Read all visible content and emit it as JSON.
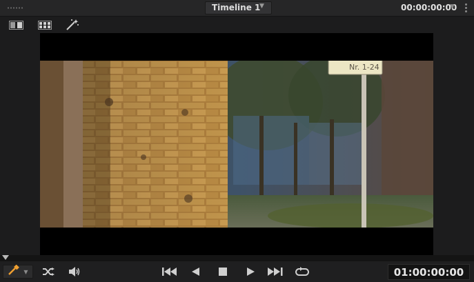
{
  "header": {
    "timeline_title": "Timeline 1",
    "timecode": "00:00:00:00"
  },
  "toolbar": {
    "icons": [
      "split-view-icon",
      "grid-view-icon",
      "magic-wand-icon"
    ]
  },
  "viewer": {
    "sign_text": "Nr. 1-24"
  },
  "transport": {
    "timecode": "01:00:00:00",
    "icons": [
      "eyedropper-icon",
      "shuffle-icon",
      "speaker-icon",
      "skip-to-start-icon",
      "step-back-icon",
      "stop-icon",
      "play-icon",
      "skip-to-end-icon",
      "loop-icon"
    ]
  },
  "colors": {
    "accent_orange": "#f0a030",
    "panel_bg": "#1c1c1d"
  }
}
